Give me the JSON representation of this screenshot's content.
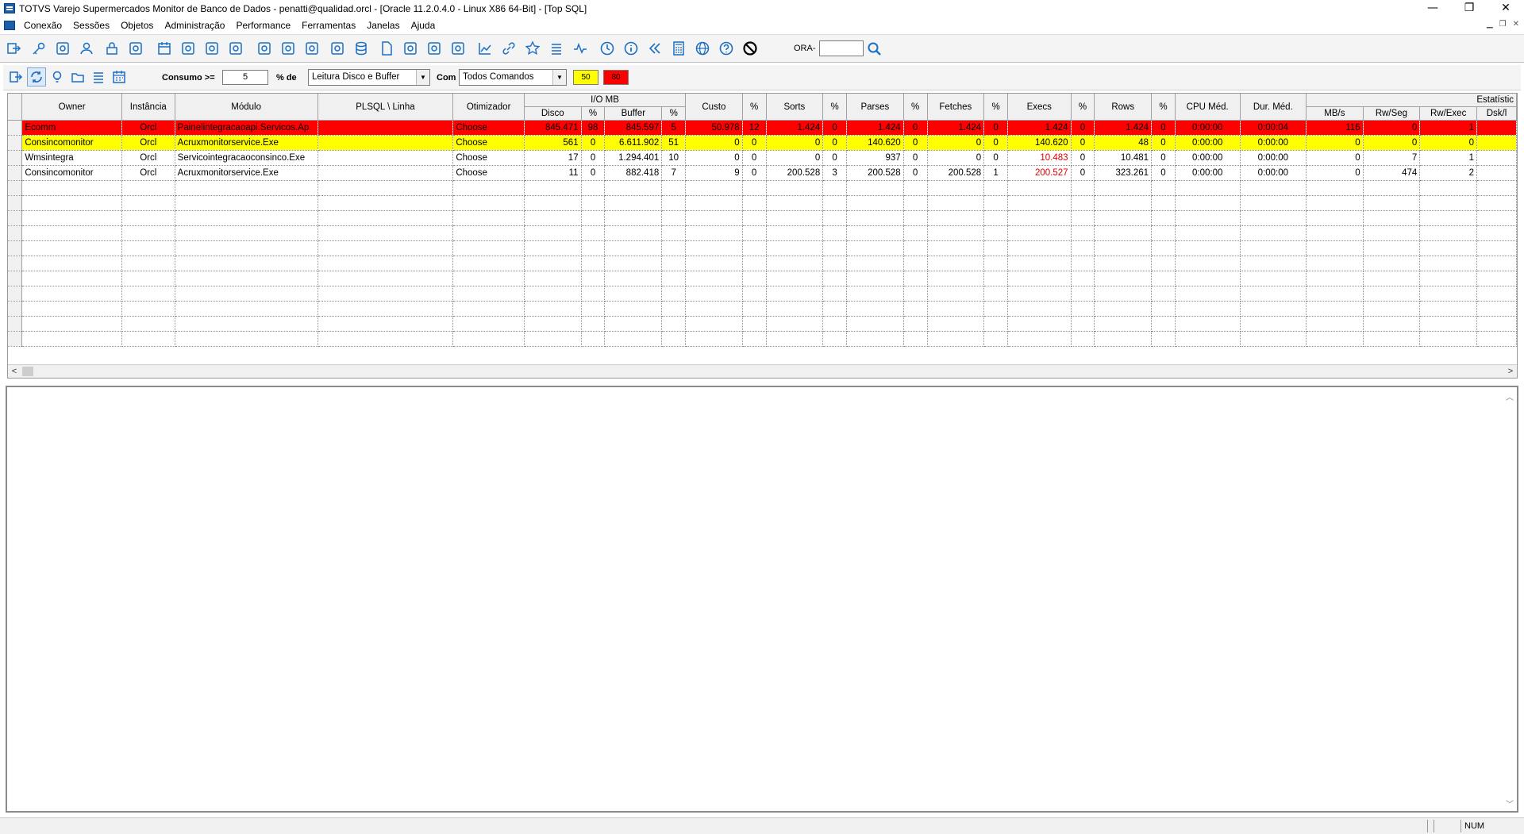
{
  "window": {
    "title": "TOTVS Varejo Supermercados Monitor de Banco de Dados - penatti@qualidad.orcl - [Oracle 11.2.0.4.0 - Linux X86 64-Bit] - [Top SQL]",
    "minimize": "—",
    "restore": "❐",
    "close": "✕"
  },
  "menu": [
    "Conexão",
    "Sessões",
    "Objetos",
    "Administração",
    "Performance",
    "Ferramentas",
    "Janelas",
    "Ajuda"
  ],
  "toolbar": {
    "ora_label": "ORA-",
    "ora_value": "",
    "icons": [
      "exit-icon",
      "key-icon",
      "key-search-icon",
      "user-icon",
      "lock-icon",
      "history-icon",
      "calendar-icon",
      "calendar-settings-icon",
      "box-icon",
      "zoom-icon",
      "report-icon",
      "storage-icon",
      "sliders-icon",
      "users-icon",
      "database-icon",
      "document-icon",
      "copy-icon",
      "file-text-icon",
      "butterfly-icon",
      "chart-icon",
      "link-icon",
      "star-icon",
      "list-icon",
      "pulse-icon",
      "clock-icon",
      "info-icon",
      "double-chevron-left-icon",
      "calculator-icon",
      "globe-icon",
      "help-icon",
      "block-icon"
    ]
  },
  "filter": {
    "consumo_label": "Consumo >=",
    "consumo_value": "5",
    "pct_de_label": "% de",
    "tipo_value": "Leitura Disco e Buffer",
    "com_label": "Com",
    "comandos_value": "Todos Comandos",
    "threshold_yellow": "50",
    "threshold_red": "80",
    "colors": {
      "yellow": "#ffff00",
      "red": "#ff0000"
    }
  },
  "grid": {
    "group_headers": {
      "io_mb": "I/O MB",
      "estatisticas": "Estatístic"
    },
    "headers": {
      "owner": "Owner",
      "instancia": "Instância",
      "modulo": "Módulo",
      "plsql": "PLSQL \\ Linha",
      "otimizador": "Otimizador",
      "disco": "Disco",
      "disco_pct": "%",
      "buffer": "Buffer",
      "buffer_pct": "%",
      "custo": "Custo",
      "custo_pct": "%",
      "sorts": "Sorts",
      "sorts_pct": "%",
      "parses": "Parses",
      "parses_pct": "%",
      "fetches": "Fetches",
      "fetches_pct": "%",
      "execs": "Execs",
      "execs_pct": "%",
      "rows": "Rows",
      "rows_pct": "%",
      "cpu_med": "CPU Méd.",
      "dur_med": "Dur. Méd.",
      "mbs": "MB/s",
      "rwseg": "Rw/Seg",
      "rwexec": "Rw/Exec",
      "dskl": "Dsk/l"
    },
    "rows": [
      {
        "highlight": "red",
        "owner": "Ecomm",
        "instancia": "Orcl",
        "modulo": "Painelintegracaoapi.Servicos.Ap",
        "plsql": "",
        "otimizador": "Choose",
        "disco": "845.471",
        "disco_pct": "98",
        "buffer": "845.597",
        "buffer_pct": "5",
        "custo": "50.978",
        "custo_pct": "12",
        "sorts": "1.424",
        "sorts_pct": "0",
        "parses": "1.424",
        "parses_pct": "0",
        "fetches": "1.424",
        "fetches_pct": "0",
        "execs": "1.424",
        "execs_pct": "0",
        "rows": "1.424",
        "rows_pct": "0",
        "cpu_med": "0:00:00",
        "dur_med": "0:00:04",
        "mbs": "116",
        "rwseg": "0",
        "rwexec": "1",
        "dskl": ""
      },
      {
        "highlight": "yellow",
        "owner": "Consincomonitor",
        "instancia": "Orcl",
        "modulo": "Acruxmonitorservice.Exe",
        "plsql": "",
        "otimizador": "Choose",
        "disco": "561",
        "disco_pct": "0",
        "buffer": "6.611.902",
        "buffer_pct": "51",
        "custo": "0",
        "custo_pct": "0",
        "sorts": "0",
        "sorts_pct": "0",
        "parses": "140.620",
        "parses_pct": "0",
        "fetches": "0",
        "fetches_pct": "0",
        "execs": "140.620",
        "execs_pct": "0",
        "rows": "48",
        "rows_pct": "0",
        "cpu_med": "0:00:00",
        "dur_med": "0:00:00",
        "mbs": "0",
        "rwseg": "0",
        "rwexec": "0",
        "dskl": ""
      },
      {
        "highlight": "none",
        "owner": "Wmsintegra",
        "instancia": "Orcl",
        "modulo": "Servicointegracaoconsinco.Exe",
        "plsql": "",
        "otimizador": "Choose",
        "disco": "17",
        "disco_pct": "0",
        "buffer": "1.294.401",
        "buffer_pct": "10",
        "custo": "0",
        "custo_pct": "0",
        "sorts": "0",
        "sorts_pct": "0",
        "parses": "937",
        "parses_pct": "0",
        "fetches": "0",
        "fetches_pct": "0",
        "execs": "10.483",
        "execs_red": true,
        "execs_pct": "0",
        "rows": "10.481",
        "rows_pct": "0",
        "cpu_med": "0:00:00",
        "dur_med": "0:00:00",
        "mbs": "0",
        "rwseg": "7",
        "rwexec": "1",
        "dskl": ""
      },
      {
        "highlight": "none",
        "owner": "Consincomonitor",
        "instancia": "Orcl",
        "modulo": "Acruxmonitorservice.Exe",
        "plsql": "",
        "otimizador": "Choose",
        "disco": "11",
        "disco_pct": "0",
        "buffer": "882.418",
        "buffer_pct": "7",
        "custo": "9",
        "custo_pct": "0",
        "sorts": "200.528",
        "sorts_pct": "3",
        "parses": "200.528",
        "parses_pct": "0",
        "fetches": "200.528",
        "fetches_pct": "1",
        "execs": "200.527",
        "execs_red": true,
        "execs_pct": "0",
        "rows": "323.261",
        "rows_pct": "0",
        "cpu_med": "0:00:00",
        "dur_med": "0:00:00",
        "mbs": "0",
        "rwseg": "474",
        "rwexec": "2",
        "dskl": ""
      }
    ],
    "empty_rows": 11
  },
  "statusbar": {
    "num": "NUM"
  }
}
